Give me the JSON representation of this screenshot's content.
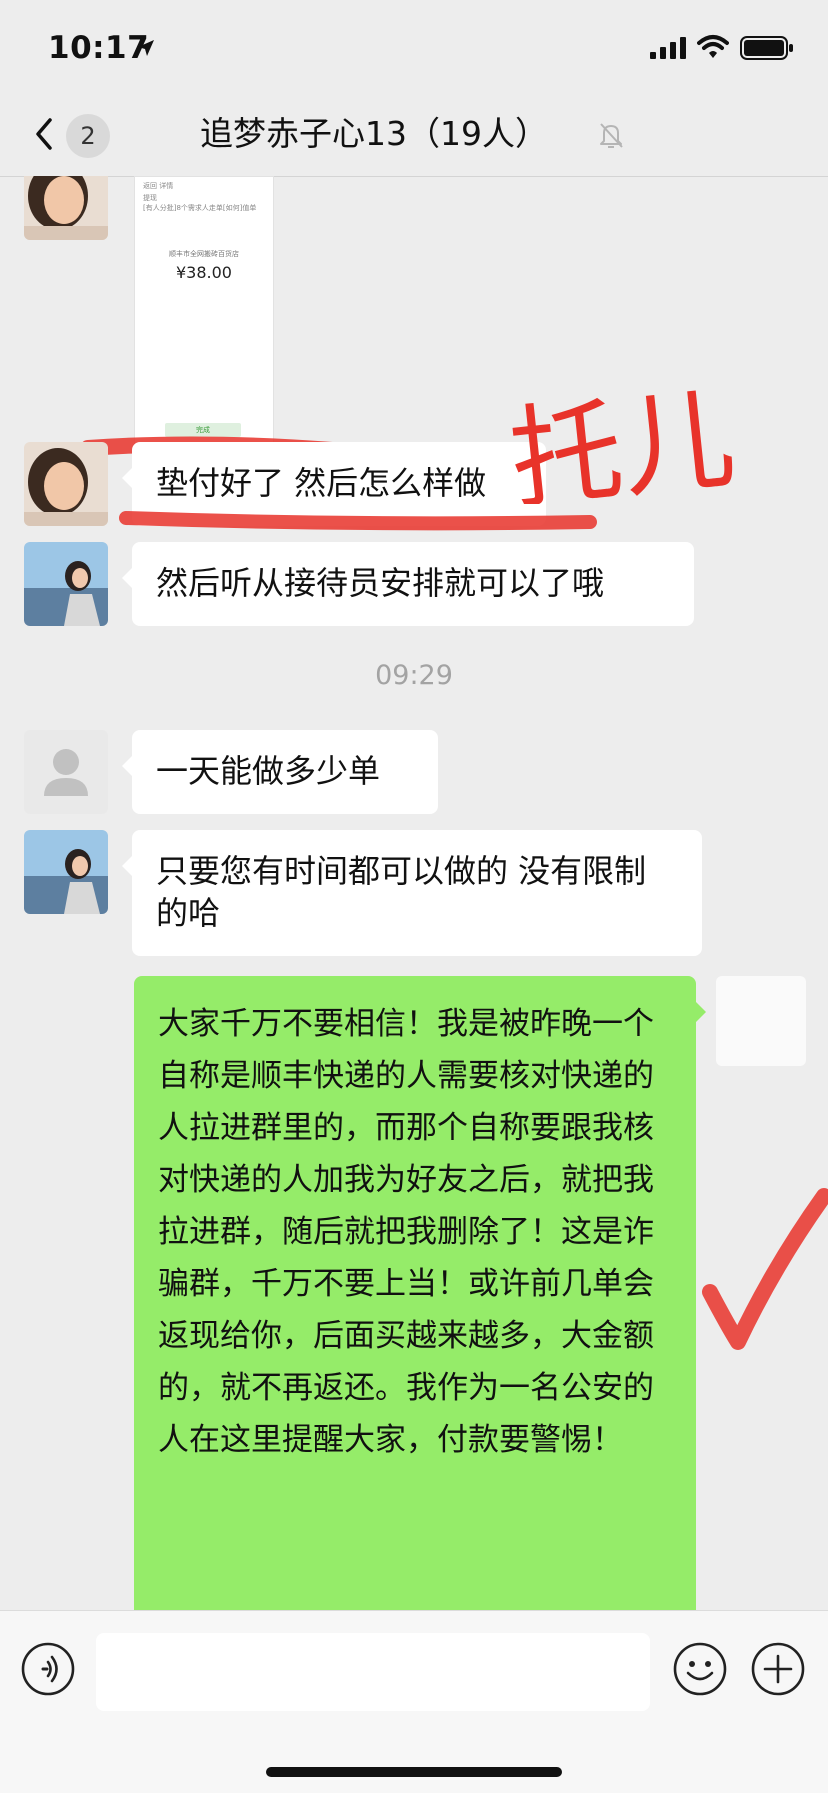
{
  "status_bar": {
    "time": "10:17"
  },
  "nav": {
    "unread_count": "2",
    "title": "追梦赤子心13（19人）"
  },
  "messages": [
    {
      "text": "垫付好了 然后怎么样做"
    },
    {
      "text": "然后听从接待员安排就可以了哦"
    },
    {
      "text": "一天能做多少单"
    },
    {
      "text": "只要您有时间都可以做的 没有限制的哈"
    },
    {
      "text": "大家千万不要相信！我是被昨晚一个自称是顺丰快递的人需要核对快递的人拉进群里的，而那个自称要跟我核对快递的人加我为好友之后，就把我拉进群，随后就把我删除了！这是诈骗群，千万不要上当！或许前几单会返现给你，后面买越来越多，大金额的，就不再返还。我作为一名公安的人在这里提醒大家，付款要警惕！"
    }
  ],
  "time_separator": "09:29",
  "receipt": {
    "header": "返回 详情",
    "line1": "提现",
    "line2": "[有人分批]8个需求人走单[如何]值单",
    "shop": "顺丰市全网搬砖百货店",
    "amount": "¥38.00",
    "done_label": "完成"
  },
  "annotation": {
    "text": "托儿",
    "color": "#e8332a"
  },
  "colors": {
    "own_bubble": "#95ec69",
    "background": "#ededed"
  }
}
